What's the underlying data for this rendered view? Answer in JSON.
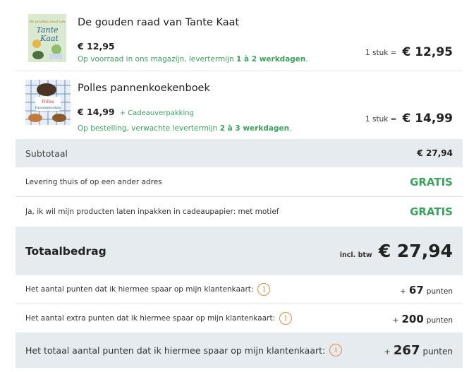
{
  "products": [
    {
      "title": "De gouden raad van Tante Kaat",
      "cover_title": "De gouden raad van Tante Kaat",
      "price": "€ 12,95",
      "extra": "",
      "stock_prefix": "Op voorraad in ons magazijn, levertermijn ",
      "stock_days": "1 à 2 werkdagen",
      "stock_suffix": ".",
      "quantity": "1 stuk =",
      "line_total": "€ 12,95"
    },
    {
      "title": "Polles pannenkoekenboek",
      "cover_title": "Polles Pannenkoeken boek",
      "price": "€ 14,99",
      "extra": "+ Cadeauverpakking",
      "stock_prefix": "Op bestelling, verwachte levertermijn ",
      "stock_days": "2 à 3 werkdagen",
      "stock_suffix": ".",
      "quantity": "1 stuk =",
      "line_total": "€ 14,99"
    }
  ],
  "summary": {
    "subtotal_label": "Subtotaal",
    "subtotal_value": "€ 27,94",
    "delivery_label": "Levering thuis of op een ander adres",
    "delivery_value": "GRATIS",
    "giftwrap_label": "Ja, ik wil mijn producten laten inpakken in cadeaupapier: met motief",
    "giftwrap_value": "GRATIS",
    "total_label": "Totaalbedrag",
    "total_vat": "incl. btw",
    "total_value": "€ 27,94"
  },
  "points": [
    {
      "label": "Het aantal punten dat ik hiermee spaar op mijn klantenkaart:",
      "plus": "+",
      "value": "67",
      "unit": "punten",
      "icon": "info-icon"
    },
    {
      "label": "Het aantal extra punten dat ik hiermee spaar op mijn klantenkaart:",
      "plus": "+",
      "value": "200",
      "unit": "punten",
      "icon": "info-icon"
    },
    {
      "label": "Het totaal aantal punten dat ik hiermee spaar op mijn klantenkaart:",
      "plus": "+",
      "value": "267",
      "unit": "punten",
      "icon": "info-icon"
    }
  ],
  "colors": {
    "accent_green": "#3aa35c",
    "info_orange": "#e08a3c",
    "row_shade": "#e6ebef"
  }
}
